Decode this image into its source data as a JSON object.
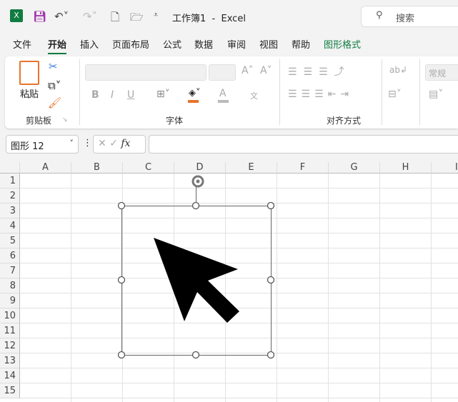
{
  "titlebar": {
    "title": "工作簿1  -  Excel",
    "search_placeholder": "搜索"
  },
  "tabs": [
    "文件",
    "开始",
    "插入",
    "页面布局",
    "公式",
    "数据",
    "审阅",
    "视图",
    "帮助",
    "图形格式"
  ],
  "active_tab": "开始",
  "ribbon": {
    "clipboard": {
      "label": "剪贴板",
      "paste": "粘贴"
    },
    "font": {
      "label": "字体",
      "bold": "B",
      "italic": "I",
      "underline": "U",
      "font_color": "A",
      "phonetic": "文"
    },
    "alignment": {
      "label": "对齐方式"
    },
    "number": {
      "format": "常规"
    }
  },
  "formula_bar": {
    "name_box": "图形 12",
    "formula": "",
    "fx": "fx"
  },
  "columns": [
    "A",
    "B",
    "C",
    "D",
    "E",
    "F",
    "G",
    "H",
    "I"
  ],
  "rows": [
    "1",
    "2",
    "3",
    "4",
    "5",
    "6",
    "7",
    "8",
    "9",
    "10",
    "11",
    "12",
    "13",
    "14",
    "15"
  ],
  "colors": {
    "accent": "#107c41",
    "fill_orange": "#e8742c"
  }
}
